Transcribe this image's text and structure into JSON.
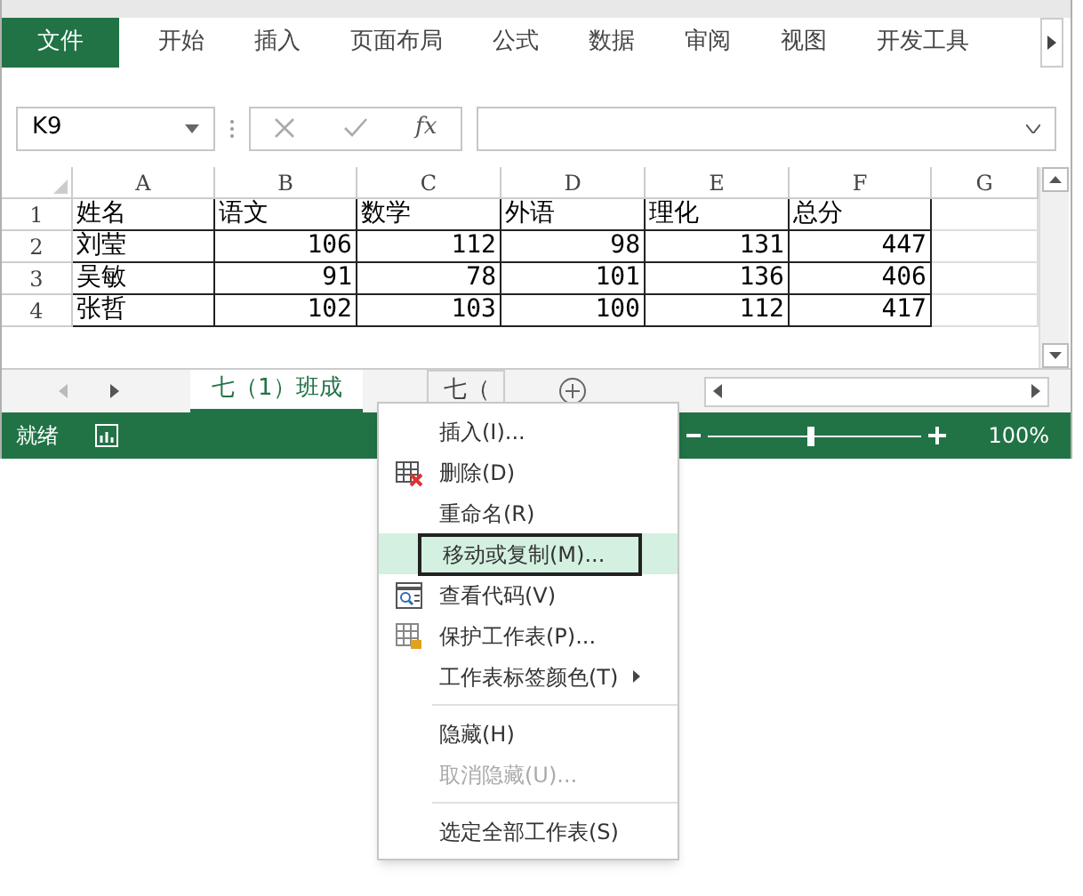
{
  "ribbon_tabs": [
    {
      "label": "文件",
      "selected": true
    },
    {
      "label": "开始",
      "selected": false
    },
    {
      "label": "插入",
      "selected": false
    },
    {
      "label": "页面布局",
      "selected": false
    },
    {
      "label": "公式",
      "selected": false
    },
    {
      "label": "数据",
      "selected": false
    },
    {
      "label": "审阅",
      "selected": false
    },
    {
      "label": "视图",
      "selected": false
    },
    {
      "label": "开发工具",
      "selected": false
    }
  ],
  "formula_bar": {
    "name_box": "K9",
    "fx": "fx"
  },
  "table": {
    "columns": [
      "A",
      "B",
      "C",
      "D",
      "E",
      "F",
      "G"
    ],
    "rows": [
      {
        "header": "1",
        "cells": [
          "姓名",
          "语文",
          "数学",
          "外语",
          "理化",
          "总分",
          ""
        ]
      },
      {
        "header": "2",
        "cells": [
          "刘莹",
          "106",
          "112",
          "98",
          "131",
          "447",
          ""
        ]
      },
      {
        "header": "3",
        "cells": [
          "吴敏",
          "91",
          "78",
          "101",
          "136",
          "406",
          ""
        ]
      },
      {
        "header": "4",
        "cells": [
          "张哲",
          "102",
          "103",
          "100",
          "112",
          "417",
          ""
        ]
      }
    ]
  },
  "sheet_tabs": [
    {
      "label": "七（1）班成",
      "selected": true
    },
    {
      "label": "七（",
      "selected": false
    }
  ],
  "status_bar": {
    "status": "就绪",
    "zoom": {
      "level": 0.49,
      "reading": "100%"
    }
  },
  "context_menu": [
    {
      "kind": "plain",
      "label": "插入(I)...",
      "disabled": false,
      "selected": false,
      "submenu": false
    },
    {
      "kind": "delete",
      "label": "删除(D)",
      "disabled": false,
      "selected": false,
      "submenu": false
    },
    {
      "kind": "plain",
      "label": "重命名(R)",
      "disabled": false,
      "selected": false,
      "submenu": false
    },
    {
      "kind": "plain",
      "label": "移动或复制(M)...",
      "disabled": false,
      "selected": true,
      "submenu": false
    },
    {
      "kind": "code",
      "label": "查看代码(V)",
      "disabled": false,
      "selected": false,
      "submenu": false
    },
    {
      "kind": "protect",
      "label": "保护工作表(P)...",
      "disabled": false,
      "selected": false,
      "submenu": false
    },
    {
      "kind": "plain",
      "label": "工作表标签颜色(T)",
      "disabled": false,
      "selected": false,
      "submenu": true
    },
    {
      "kind": "separator"
    },
    {
      "kind": "plain",
      "label": "隐藏(H)",
      "disabled": false,
      "selected": false,
      "submenu": false
    },
    {
      "kind": "plain",
      "label": "取消隐藏(U)...",
      "disabled": true,
      "selected": false,
      "submenu": false
    },
    {
      "kind": "separator"
    },
    {
      "kind": "plain",
      "label": "选定全部工作表(S)",
      "disabled": false,
      "selected": false,
      "submenu": false
    }
  ]
}
